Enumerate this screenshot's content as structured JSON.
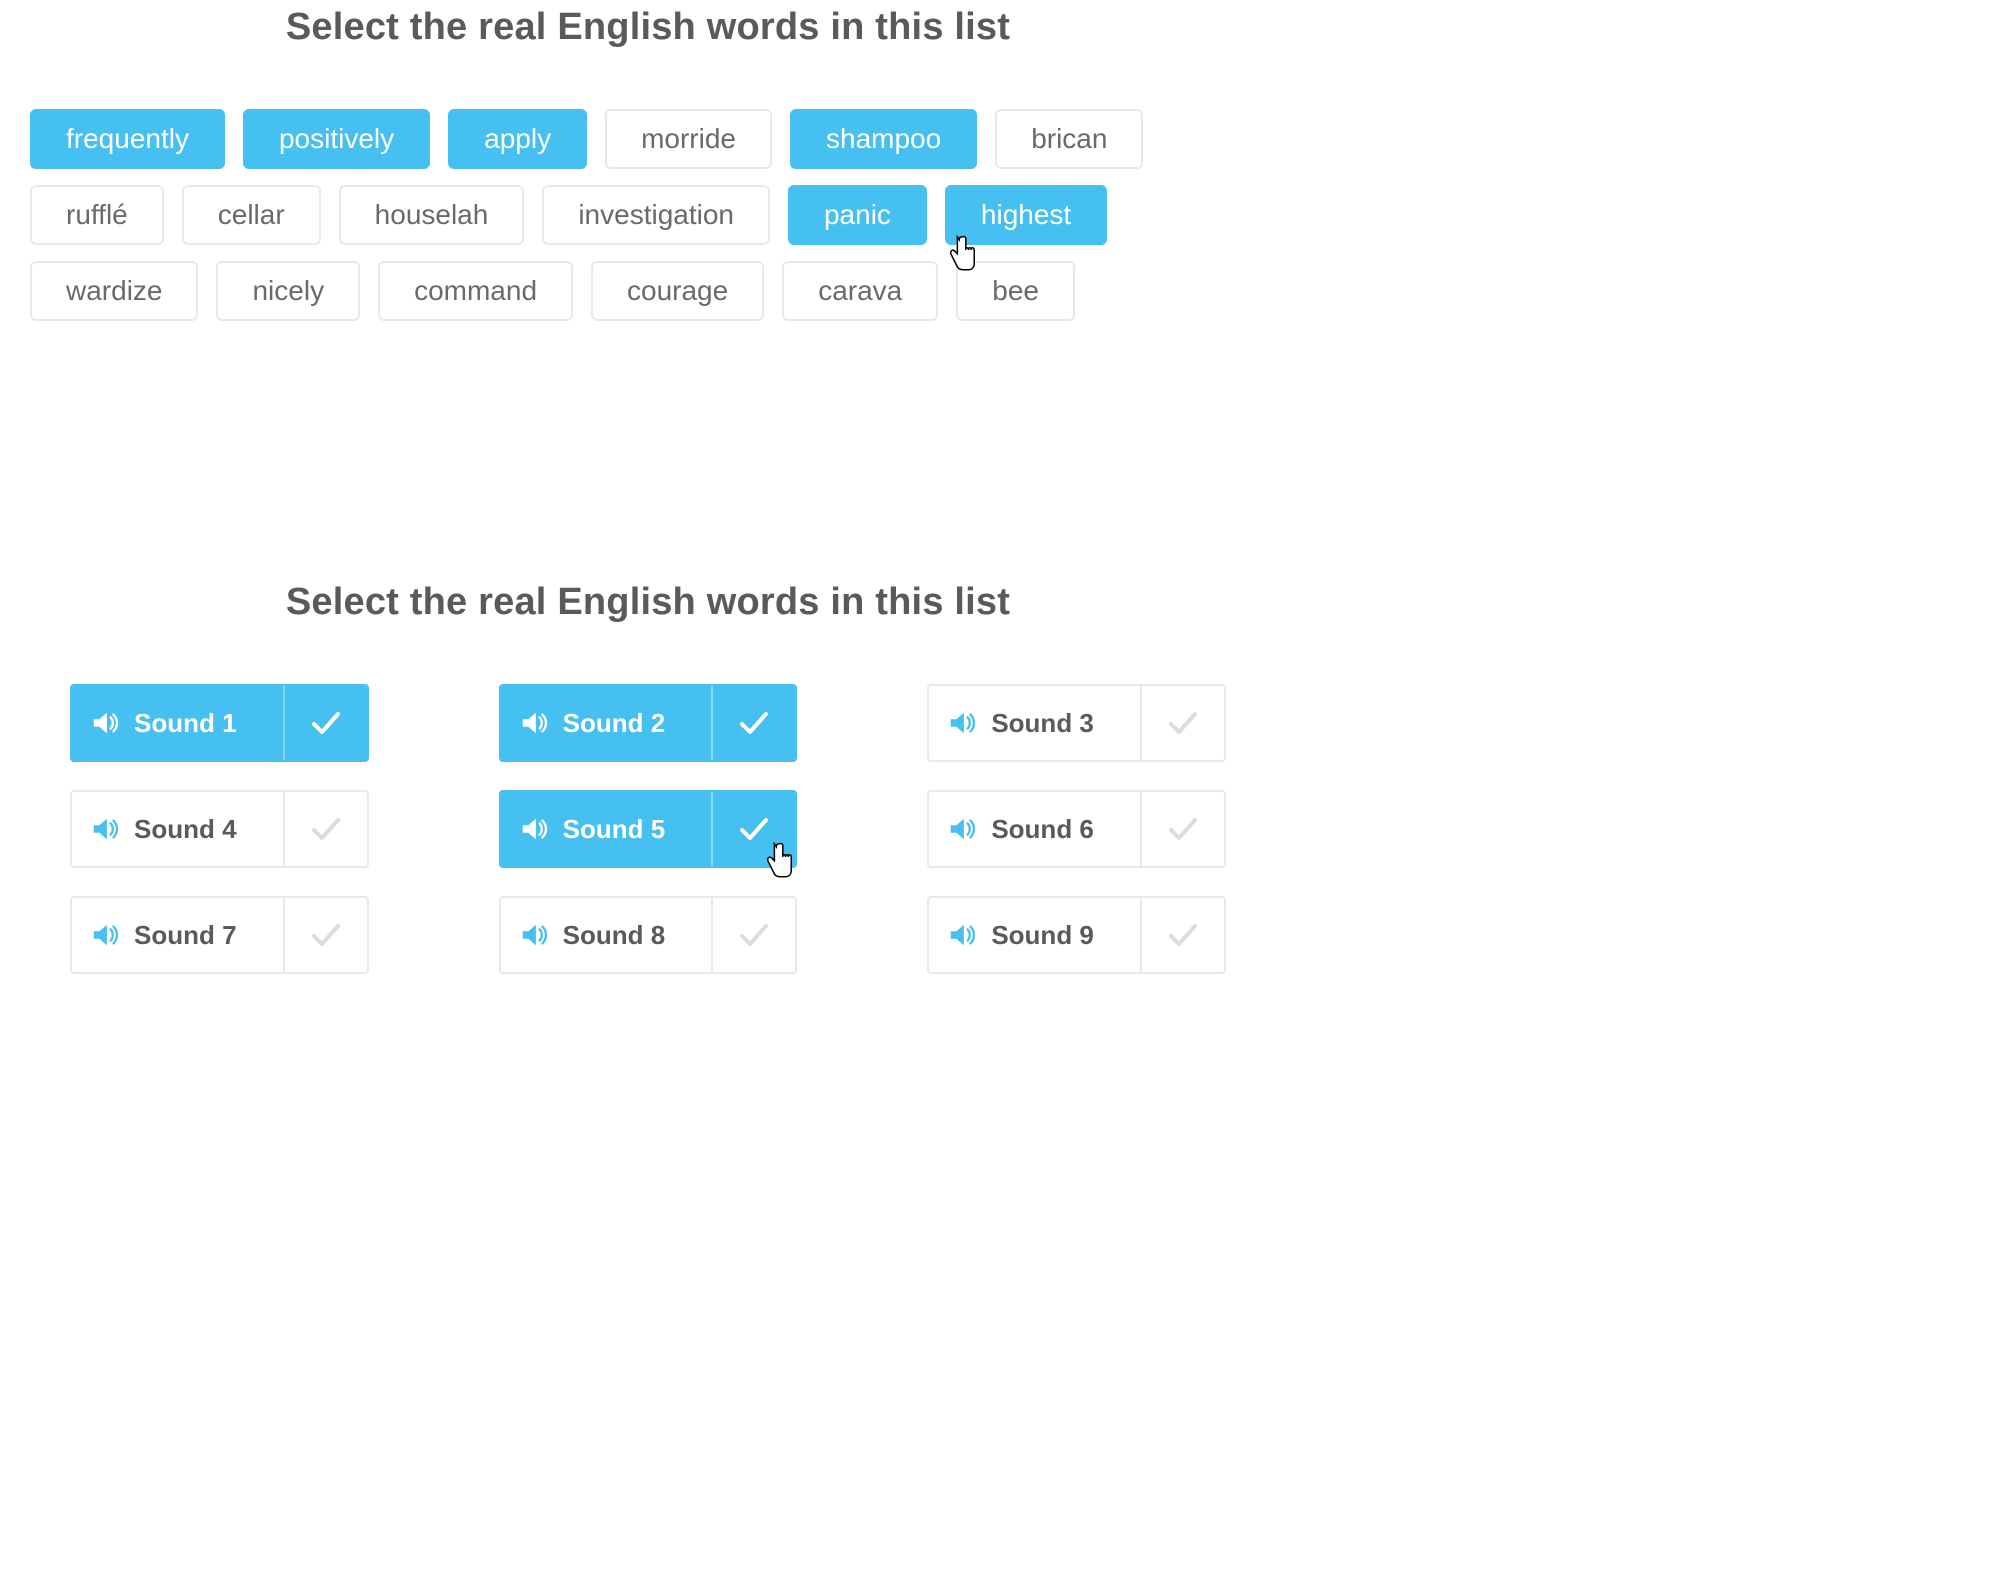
{
  "colors": {
    "accent": "#46c0f0",
    "border": "#e9e9e9",
    "text": "#5a5a5a",
    "muted_check": "#dcdcdc"
  },
  "q1": {
    "title": "Select the real English words in this list",
    "chips": [
      {
        "label": "frequently",
        "selected": true
      },
      {
        "label": "positively",
        "selected": true
      },
      {
        "label": "apply",
        "selected": true
      },
      {
        "label": "morride",
        "selected": false
      },
      {
        "label": "shampoo",
        "selected": true
      },
      {
        "label": "brican",
        "selected": false
      },
      {
        "label": "rufflé",
        "selected": false
      },
      {
        "label": "cellar",
        "selected": false
      },
      {
        "label": "houselah",
        "selected": false
      },
      {
        "label": "investigation",
        "selected": false
      },
      {
        "label": "panic",
        "selected": true
      },
      {
        "label": "highest",
        "selected": true
      },
      {
        "label": "wardize",
        "selected": false
      },
      {
        "label": "nicely",
        "selected": false
      },
      {
        "label": "command",
        "selected": false
      },
      {
        "label": "courage",
        "selected": false
      },
      {
        "label": "carava",
        "selected": false
      },
      {
        "label": "bee",
        "selected": false
      }
    ]
  },
  "q2": {
    "title": "Select the real English words in this list",
    "sounds": [
      {
        "label": "Sound 1",
        "selected": true
      },
      {
        "label": "Sound 2",
        "selected": true
      },
      {
        "label": "Sound 3",
        "selected": false
      },
      {
        "label": "Sound 4",
        "selected": false
      },
      {
        "label": "Sound 5",
        "selected": true
      },
      {
        "label": "Sound 6",
        "selected": false
      },
      {
        "label": "Sound 7",
        "selected": false
      },
      {
        "label": "Sound 8",
        "selected": false
      },
      {
        "label": "Sound 9",
        "selected": false
      }
    ]
  }
}
